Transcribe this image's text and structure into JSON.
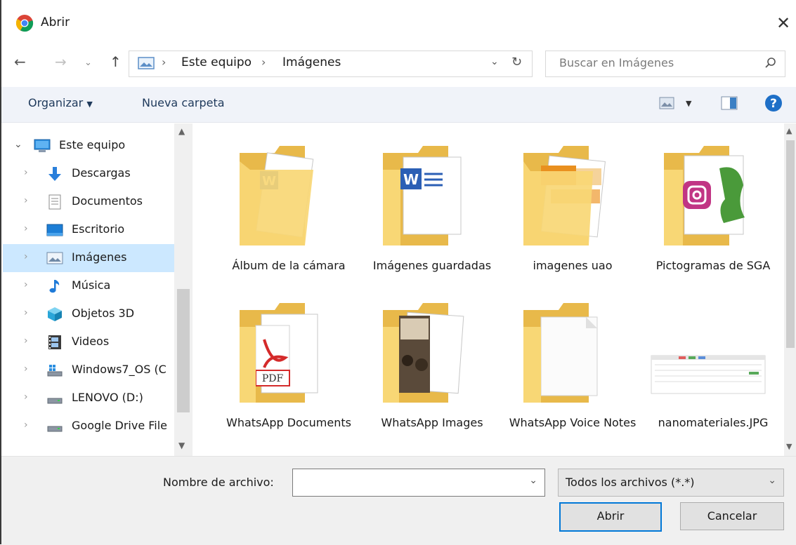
{
  "window": {
    "title": "Abrir"
  },
  "address": {
    "segments": [
      "Este equipo",
      "Imágenes"
    ]
  },
  "search": {
    "placeholder": "Buscar en Imágenes"
  },
  "toolbar": {
    "organize_label": "Organizar",
    "new_folder_label": "Nueva carpeta"
  },
  "sidebar": {
    "items": [
      {
        "label": "Este equipo",
        "icon": "computer-icon",
        "expanded": true
      },
      {
        "label": "Descargas",
        "icon": "download-arrow-icon"
      },
      {
        "label": "Documentos",
        "icon": "document-icon"
      },
      {
        "label": "Escritorio",
        "icon": "desktop-icon"
      },
      {
        "label": "Imágenes",
        "icon": "pictures-icon",
        "selected": true
      },
      {
        "label": "Música",
        "icon": "music-note-icon"
      },
      {
        "label": "Objetos 3D",
        "icon": "cube-3d-icon"
      },
      {
        "label": "Videos",
        "icon": "film-icon"
      },
      {
        "label": "Windows7_OS (C",
        "icon": "windows-drive-icon"
      },
      {
        "label": "LENOVO (D:)",
        "icon": "drive-icon"
      },
      {
        "label": "Google Drive File",
        "icon": "drive-icon"
      }
    ]
  },
  "files": {
    "items": [
      {
        "label": "Álbum de la cámara",
        "icon": "folder-word-icon"
      },
      {
        "label": "Imágenes guardadas",
        "icon": "folder-word-icon"
      },
      {
        "label": "imagenes uao",
        "icon": "folder-orange-docs-icon"
      },
      {
        "label": "Pictogramas de SGA",
        "icon": "folder-instagram-icon"
      },
      {
        "label": "WhatsApp Documents",
        "icon": "folder-pdf-icon"
      },
      {
        "label": "WhatsApp Images",
        "icon": "folder-photo-icon"
      },
      {
        "label": "WhatsApp Voice Notes",
        "icon": "folder-blank-icon"
      },
      {
        "label": "nanomateriales.JPG",
        "icon": "image-thumbnail-icon"
      }
    ]
  },
  "footer": {
    "filename_label": "Nombre de archivo:",
    "filename_value": "",
    "filetype_value": "Todos los archivos (*.*)",
    "open_label": "Abrir",
    "cancel_label": "Cancelar"
  },
  "colors": {
    "accent": "#0078d7",
    "selection": "#cce8ff",
    "folder": "#f8d775",
    "toolbar_bg": "#f0f3f9"
  }
}
